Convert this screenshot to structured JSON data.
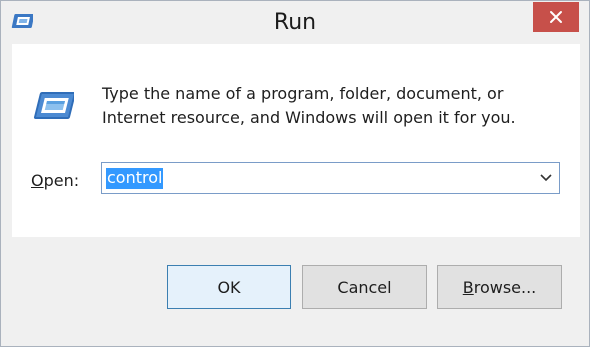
{
  "window": {
    "title": "Run",
    "close_icon": "close-icon",
    "title_icon": "run-icon",
    "close_color": "#c7504a"
  },
  "dialog": {
    "description_line1": "Type the name of a program, folder, document, or",
    "description_line2": "Internet resource, and Windows will open it for you.",
    "open_label_mnemonic": "O",
    "open_label_rest": "pen:",
    "combo_value": "control",
    "combo_arrow_icon": "chevron-down-icon",
    "selection_color": "#3399ff"
  },
  "buttons": {
    "ok": "OK",
    "cancel": "Cancel",
    "browse_mnemonic": "B",
    "browse_rest": "rowse..."
  }
}
